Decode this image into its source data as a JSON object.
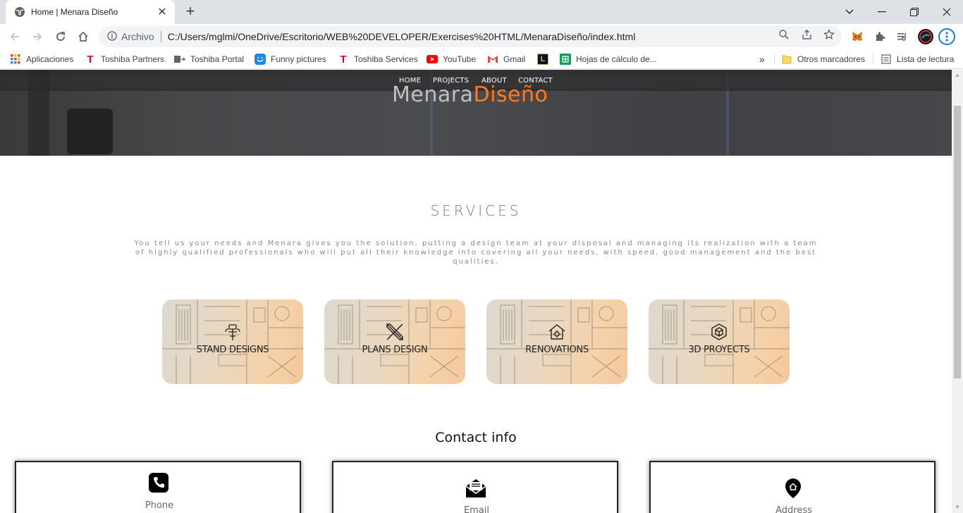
{
  "browser": {
    "tab_title": "Home | Menara Diseño",
    "scheme_label": "Archivo",
    "url": "C:/Users/mglmi/OneDrive/Escritorio/WEB%20DEVELOPER/Exercises%20HTML/MenaraDiseño/index.html",
    "bookmarks": [
      {
        "label": "Aplicaciones",
        "icon": "apps-grid-icon"
      },
      {
        "label": "Toshiba Partners",
        "icon": "toshiba-icon"
      },
      {
        "label": "Toshiba Portal",
        "icon": "portal-icon"
      },
      {
        "label": "Funny pictures",
        "icon": "smiley-icon"
      },
      {
        "label": "Toshiba Services",
        "icon": "toshiba-icon"
      },
      {
        "label": "YouTube",
        "icon": "youtube-icon"
      },
      {
        "label": "Gmail",
        "icon": "gmail-icon"
      },
      {
        "label": "",
        "icon": "lol-icon"
      },
      {
        "label": "Hojas de cálculo de...",
        "icon": "sheets-icon"
      }
    ],
    "overflow_label": "»",
    "other_bookmarks": "Otros marcadores",
    "reading_list": "Lista de lectura"
  },
  "page": {
    "nav": [
      "HOME",
      "PROJECTS",
      "ABOUT",
      "CONTACT"
    ],
    "logo_part1": "Menara",
    "logo_part2": "Diseño",
    "services_title": "SERVICES",
    "services_text": "You tell us your needs and Menara gives you the solution, putting a design team at your disposal and managing its realization with a team of highly qualified professionals who will put all their knowledge into covering all your needs, with speed, good management and the best qualities.",
    "services": [
      {
        "label": "STAND DESIGNS",
        "icon": "stand-design-icon"
      },
      {
        "label": "PLANS DESIGN",
        "icon": "plans-design-icon"
      },
      {
        "label": "RENOVATIONS",
        "icon": "renovations-icon"
      },
      {
        "label": "3D PROYECTS",
        "icon": "3d-projects-icon"
      }
    ],
    "contact_title": "Contact info",
    "contact": [
      {
        "label": "Phone",
        "icon": "phone-icon"
      },
      {
        "label": "Email",
        "icon": "email-icon"
      },
      {
        "label": "Address",
        "icon": "address-pin-icon"
      }
    ]
  },
  "colors": {
    "accent": "#ff7a1f",
    "logo_grey": "#bfbfbf",
    "chrome_bg": "#dee1e6"
  }
}
